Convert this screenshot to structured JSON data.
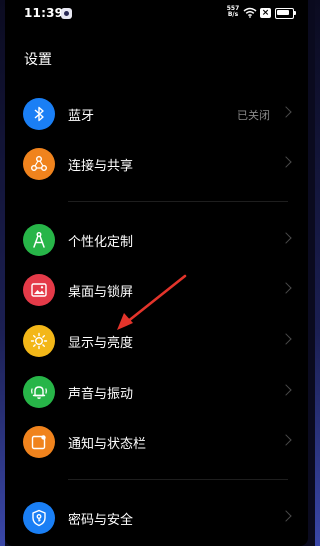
{
  "status": {
    "time": "11:39",
    "speed_top": "557",
    "speed_bottom": "B/s",
    "sim_mark": "×"
  },
  "page": {
    "title": "设置"
  },
  "menu": {
    "bluetooth": {
      "label": "蓝牙",
      "value": "已关闭",
      "icon": "bluetooth-icon",
      "color": "#1a7ff5"
    },
    "connection": {
      "label": "连接与共享",
      "icon": "share-icon",
      "color": "#f0831d"
    },
    "personalization": {
      "label": "个性化定制",
      "icon": "compass-icon",
      "color": "#27b548"
    },
    "wallpaper": {
      "label": "桌面与锁屏",
      "icon": "image-icon",
      "color": "#e43a48"
    },
    "display": {
      "label": "显示与亮度",
      "icon": "sun-icon",
      "color": "#f3b718"
    },
    "sound": {
      "label": "声音与振动",
      "icon": "bell-icon",
      "color": "#27b548"
    },
    "notification": {
      "label": "通知与状态栏",
      "icon": "notification-icon",
      "color": "#f0831d"
    },
    "security": {
      "label": "密码与安全",
      "icon": "shield-key-icon",
      "color": "#1a7ff5"
    }
  },
  "annotation": {
    "color": "#e3342b"
  }
}
